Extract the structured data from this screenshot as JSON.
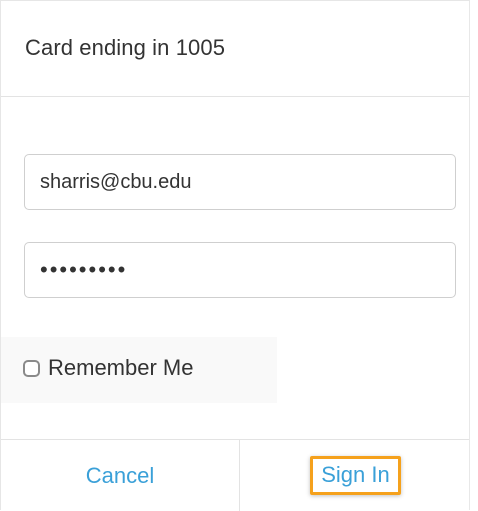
{
  "dialog": {
    "title": "Card ending in 1005"
  },
  "form": {
    "email_value": "sharris@cbu.edu",
    "password_value": "•••••••••",
    "remember_label": "Remember Me",
    "remember_checked": false
  },
  "actions": {
    "cancel_label": "Cancel",
    "signin_label": "Sign In"
  },
  "colors": {
    "link": "#3aa0d8",
    "highlight": "#f5a11c",
    "divider": "#e3e3e3"
  }
}
